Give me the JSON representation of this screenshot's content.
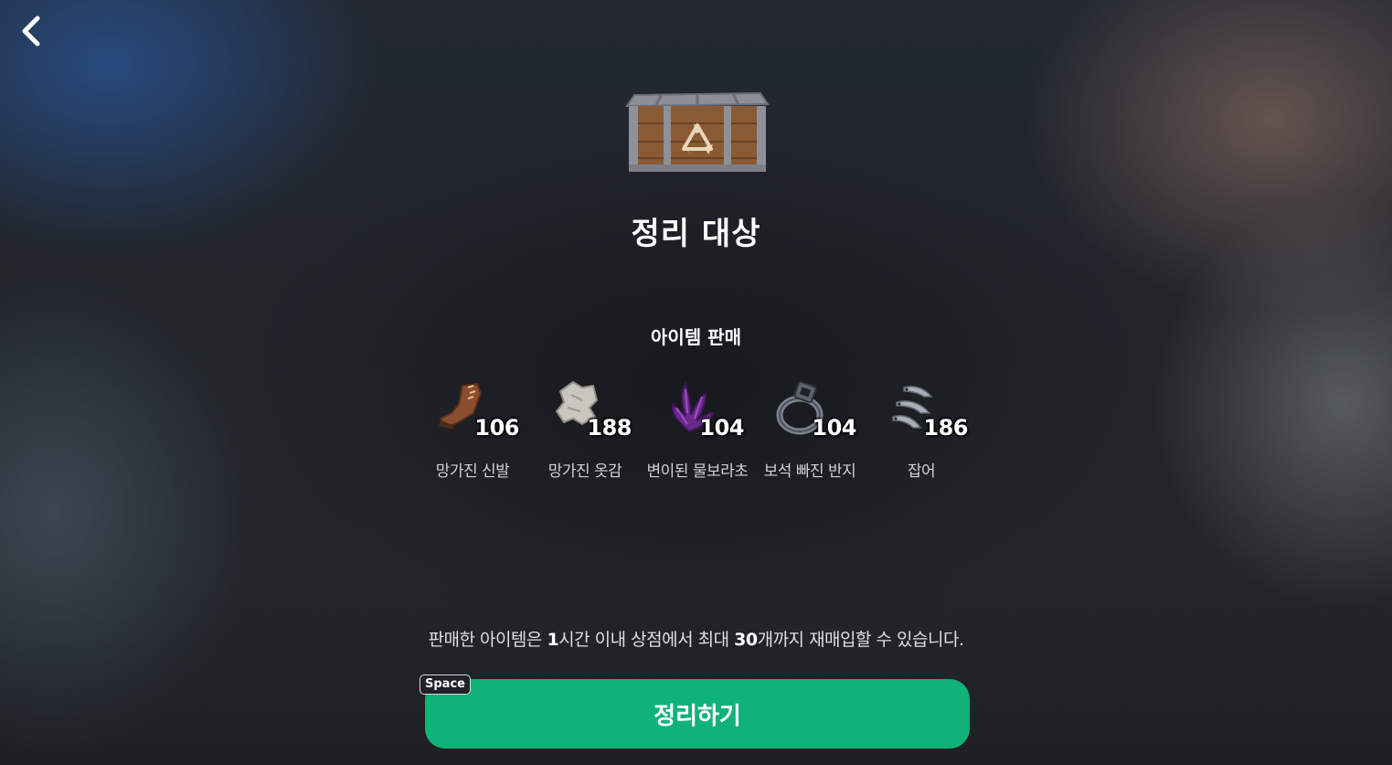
{
  "title": "정리 대상",
  "section_title": "아이템 판매",
  "items": [
    {
      "name": "망가진 신발",
      "count": "106",
      "icon": "broken-boot-icon"
    },
    {
      "name": "망가진 옷감",
      "count": "188",
      "icon": "broken-cloth-icon"
    },
    {
      "name": "변이된 물보라초",
      "count": "104",
      "icon": "mutated-plant-icon"
    },
    {
      "name": "보석 빠진 반지",
      "count": "104",
      "icon": "gemless-ring-icon"
    },
    {
      "name": "잡어",
      "count": "186",
      "icon": "small-fish-icon"
    }
  ],
  "notice": {
    "part1": "판매한 아이템은 ",
    "hour": "1",
    "part2": "시간 이내 상점에서 최대 ",
    "max": "30",
    "part3": "개까지 재매입할 수 있습니다."
  },
  "button": {
    "label": "정리하기",
    "hotkey": "Space"
  },
  "colors": {
    "button": "#10b377",
    "text": "#ffffff"
  },
  "icons": {
    "back": "chevron-left-icon",
    "crate": "recycle-crate-icon"
  }
}
